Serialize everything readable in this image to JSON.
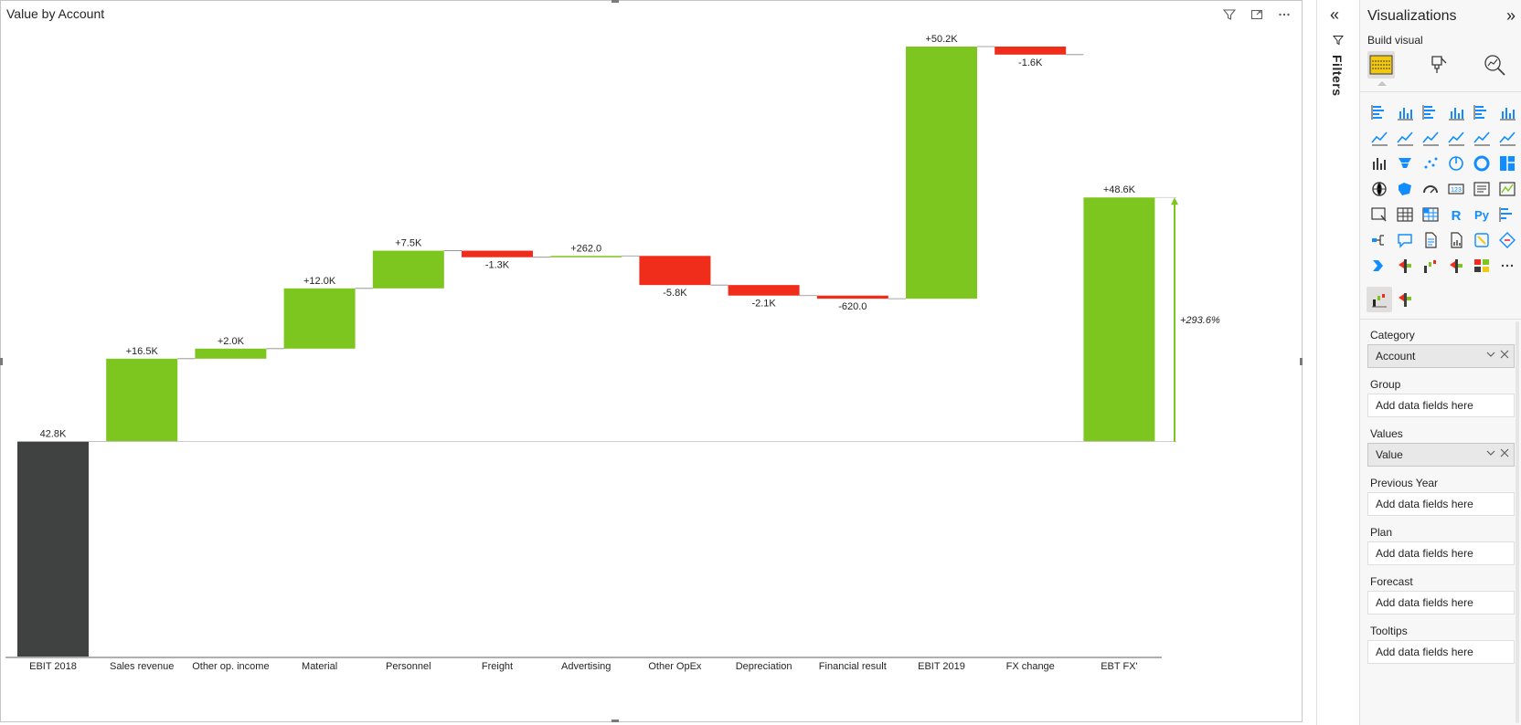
{
  "visual": {
    "title": "Value by Account"
  },
  "chart_data": {
    "type": "bar",
    "title": "Value by Account",
    "categories": [
      "EBIT 2018",
      "Sales revenue",
      "Other op. income",
      "Material",
      "Personnel",
      "Freight",
      "Advertising",
      "Other OpEx",
      "Depreciation",
      "Financial result",
      "EBIT 2019",
      "FX change",
      "EBT FX'"
    ],
    "values": [
      42.8,
      16.5,
      2.0,
      12.0,
      7.5,
      -1.3,
      0.262,
      -5.8,
      -2.1,
      -0.62,
      50.2,
      -1.6,
      48.6
    ],
    "value_units": "K",
    "kinds": [
      "total",
      "delta",
      "delta",
      "delta",
      "delta",
      "delta",
      "delta",
      "delta",
      "delta",
      "delta",
      "delta",
      "delta",
      "delta"
    ],
    "labels": [
      "42.8K",
      "+16.5K",
      "+2.0K",
      "+12.0K",
      "+7.5K",
      "-1.3K",
      "+262.0",
      "-5.8K",
      "-2.1K",
      "-620.0",
      "+50.2K",
      "-1.6K",
      "+48.6K"
    ],
    "colors": {
      "total": "#404141",
      "positive": "#7dc51f",
      "negative": "#f02c1b",
      "arrow": "#7dc51f"
    },
    "difference_arrow": {
      "label": "+293.6%"
    },
    "ylim": [
      0,
      173
    ],
    "grid": false
  },
  "filters_pane": {
    "label": "Filters"
  },
  "viz_pane": {
    "title": "Visualizations",
    "subtitle": "Build visual",
    "icons": [
      "stacked-bar-chart-icon",
      "stacked-column-chart-icon",
      "clustered-bar-chart-icon",
      "clustered-column-chart-icon",
      "100-stacked-bar-chart-icon",
      "100-stacked-column-chart-icon",
      "line-chart-icon",
      "area-chart-icon",
      "stacked-area-chart-icon",
      "line-and-stacked-column-icon",
      "line-and-clustered-column-icon",
      "ribbon-chart-icon",
      "waterfall-chart-icon",
      "funnel-chart-icon",
      "scatter-chart-icon",
      "pie-chart-icon",
      "donut-chart-icon",
      "treemap-icon",
      "map-icon",
      "filled-map-icon",
      "gauge-icon",
      "card-icon",
      "multi-row-card-icon",
      "kpi-icon",
      "slicer-icon",
      "table-icon",
      "matrix-icon",
      "r-visual-icon",
      "python-visual-icon",
      "key-influencers-icon",
      "decomposition-tree-icon",
      "qa-icon",
      "smart-narrative-icon",
      "paginated-report-icon",
      "power-apps-icon",
      "power-automate-icon",
      "chevron-visual-icon",
      "zebra-bi-charts-icon",
      "zebra-bi-waterfall-icon",
      "zebra-bi-tables-icon",
      "custom-grid-icon",
      "more-visuals-icon"
    ],
    "wells": [
      {
        "label": "Category",
        "field": "Account",
        "filled": true
      },
      {
        "label": "Group",
        "field": "Add data fields here",
        "filled": false
      },
      {
        "label": "Values",
        "field": "Value",
        "filled": true
      },
      {
        "label": "Previous Year",
        "field": "Add data fields here",
        "filled": false
      },
      {
        "label": "Plan",
        "field": "Add data fields here",
        "filled": false
      },
      {
        "label": "Forecast",
        "field": "Add data fields here",
        "filled": false
      },
      {
        "label": "Tooltips",
        "field": "Add data fields here",
        "filled": false
      }
    ]
  }
}
